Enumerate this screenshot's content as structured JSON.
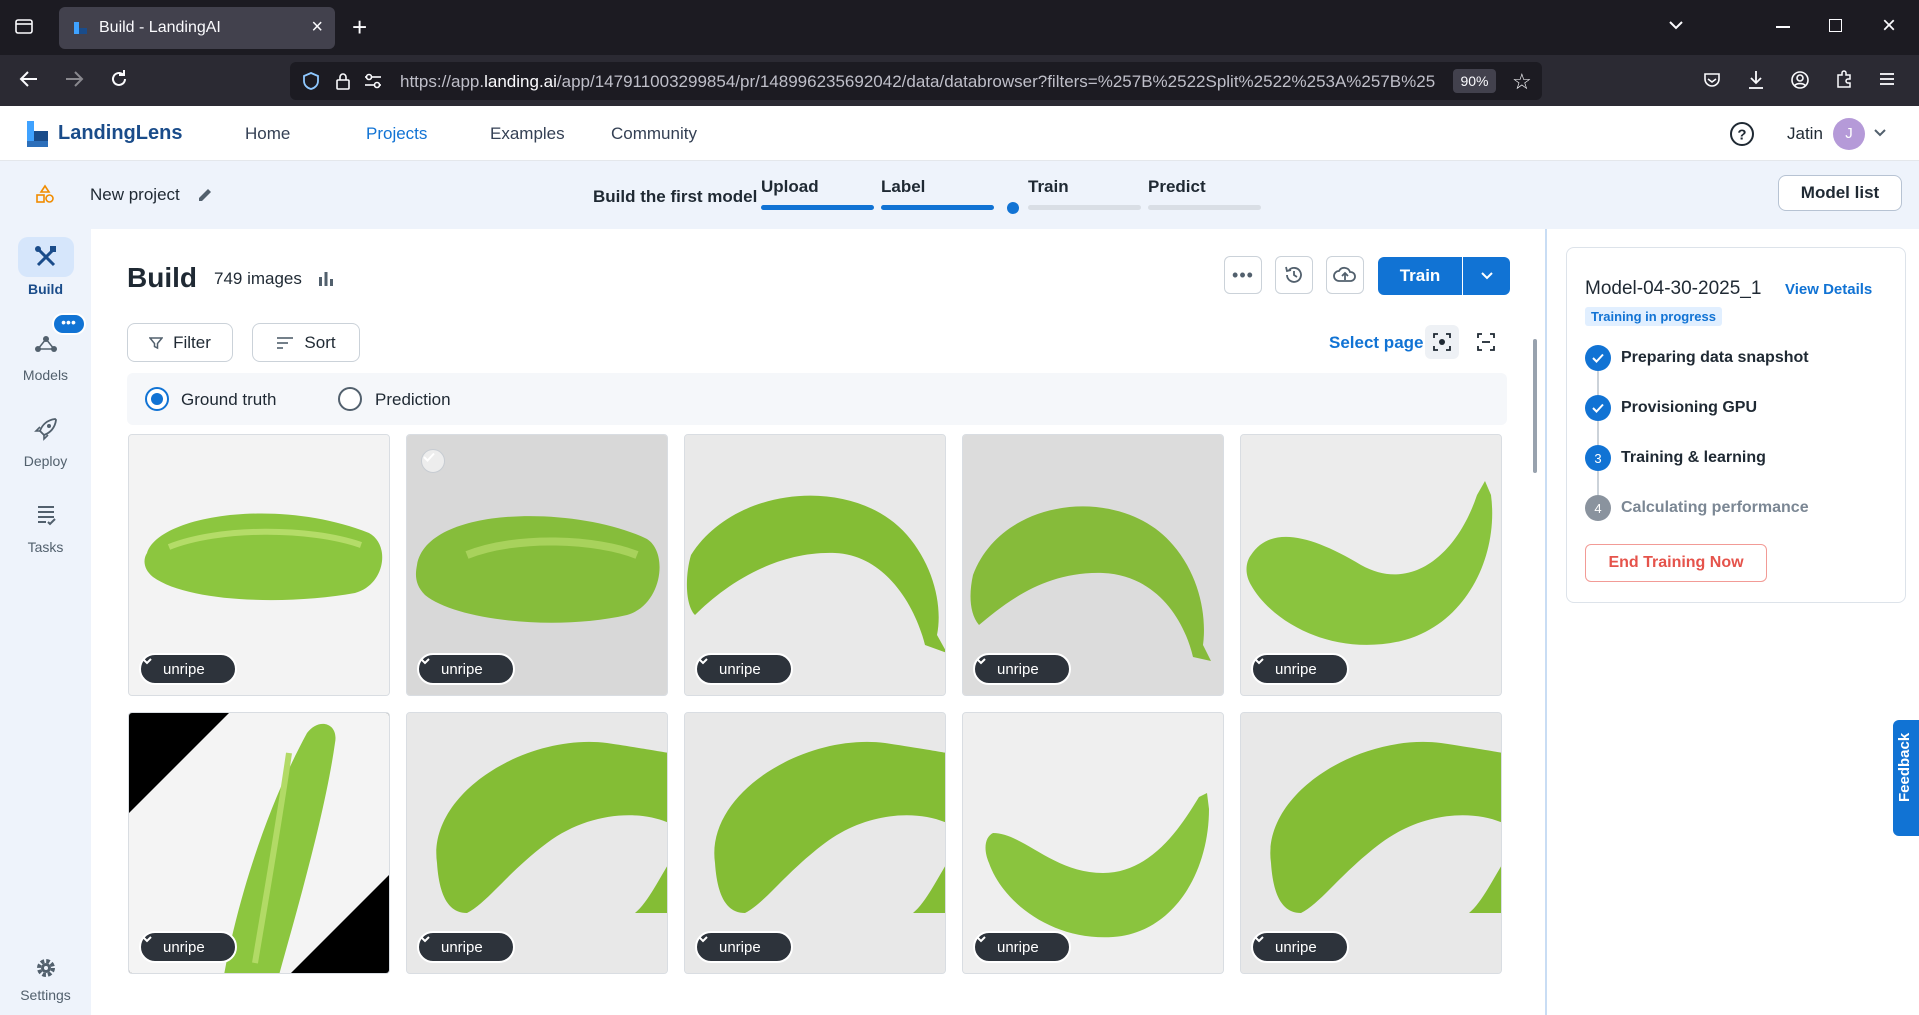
{
  "browser": {
    "tab_title": "Build - LandingAI",
    "url_prefix": "https://app.",
    "url_domain": "landing.ai",
    "url_rest": "/app/147911003299854/pr/148996235692042/data/databrowser?filters=%257B%2522Split%2522%253A%257B%25",
    "zoom": "90%"
  },
  "header": {
    "logo": "LandingLens",
    "nav": [
      {
        "label": "Home",
        "active": false
      },
      {
        "label": "Projects",
        "active": true
      },
      {
        "label": "Examples",
        "active": false
      },
      {
        "label": "Community",
        "active": false
      }
    ],
    "user_name": "Jatin",
    "user_initial": "J"
  },
  "project": {
    "name": "New project",
    "build_first_model": "Build the first model",
    "steps": [
      "Upload",
      "Label",
      "Train",
      "Predict"
    ],
    "model_list": "Model list"
  },
  "leftnav": {
    "items": [
      {
        "label": "Build",
        "active": true
      },
      {
        "label": "Models",
        "active": false
      },
      {
        "label": "Deploy",
        "active": false
      },
      {
        "label": "Tasks",
        "active": false
      }
    ],
    "settings": "Settings"
  },
  "build": {
    "title": "Build",
    "image_count": "749 images",
    "train_label": "Train",
    "filter_label": "Filter",
    "sort_label": "Sort",
    "select_page": "Select page",
    "ground_truth": "Ground truth",
    "prediction": "Prediction",
    "images": [
      {
        "label": "unripe",
        "variant": "tube"
      },
      {
        "label": "unripe",
        "variant": "tube-grain"
      },
      {
        "label": "unripe",
        "variant": "curve-right"
      },
      {
        "label": "unripe",
        "variant": "curve-grain"
      },
      {
        "label": "unripe",
        "variant": "curve-up"
      },
      {
        "label": "unripe",
        "variant": "rotated"
      },
      {
        "label": "unripe",
        "variant": "curve-left"
      },
      {
        "label": "unripe",
        "variant": "curve-left"
      },
      {
        "label": "unripe",
        "variant": "curve-small"
      },
      {
        "label": "unripe",
        "variant": "curve-left"
      }
    ]
  },
  "training": {
    "model_name": "Model-04-30-2025_1",
    "view_details": "View Details",
    "status": "Training in progress",
    "stages": [
      {
        "label": "Preparing data snapshot",
        "state": "done"
      },
      {
        "label": "Provisioning GPU",
        "state": "done"
      },
      {
        "label": "Training & learning",
        "state": "active",
        "number": "3"
      },
      {
        "label": "Calculating performance",
        "state": "pending",
        "number": "4"
      }
    ],
    "end_training": "End Training Now"
  },
  "feedback": "Feedback",
  "colors": {
    "accent": "#1173d4",
    "banana": "#8cc63f",
    "danger": "#e5534b"
  }
}
